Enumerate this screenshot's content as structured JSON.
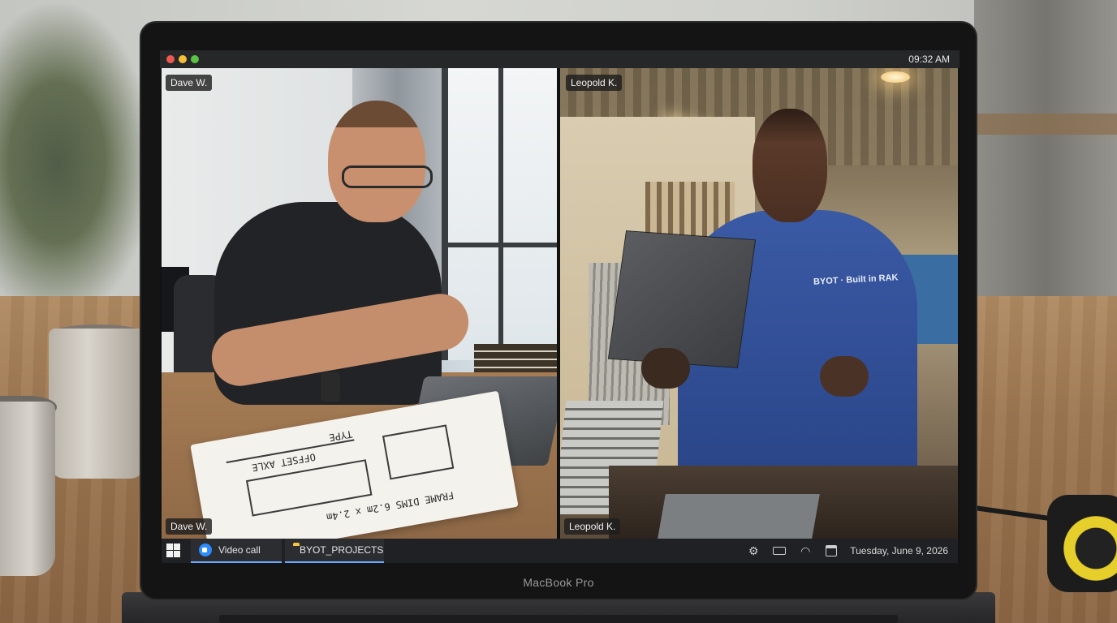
{
  "window": {
    "clock": "09:32 AM"
  },
  "participants": [
    {
      "name": "Dave W.",
      "role": "remote"
    },
    {
      "name": "Leopold K.",
      "role": "workshop"
    }
  ],
  "scene": {
    "notebook_text": [
      "OFFSET AXLE",
      "TYPE",
      "FRAME DIMS 6.2m x 2.4m"
    ],
    "coverall_patch": "BYOT · Built in RAK",
    "laptop_brand": "MacBook Pro"
  },
  "taskbar": {
    "start_icon": "windows-logo-icon",
    "items": [
      {
        "label": "Video call",
        "icon": "video-camera-icon",
        "active": true
      },
      {
        "label": "BYOT_PROJECTS",
        "icon": "folder-icon",
        "active": true
      }
    ],
    "tray": {
      "icons": [
        "gear-icon",
        "battery-icon",
        "wifi-icon",
        "calendar-icon"
      ],
      "date": "Tuesday, June 9, 2026"
    }
  },
  "colors": {
    "accent": "#6fa8ff",
    "taskbar_bg": "#202124",
    "traffic_red": "#ee5a52",
    "traffic_yellow": "#f5bd38",
    "traffic_green": "#5dc243"
  }
}
